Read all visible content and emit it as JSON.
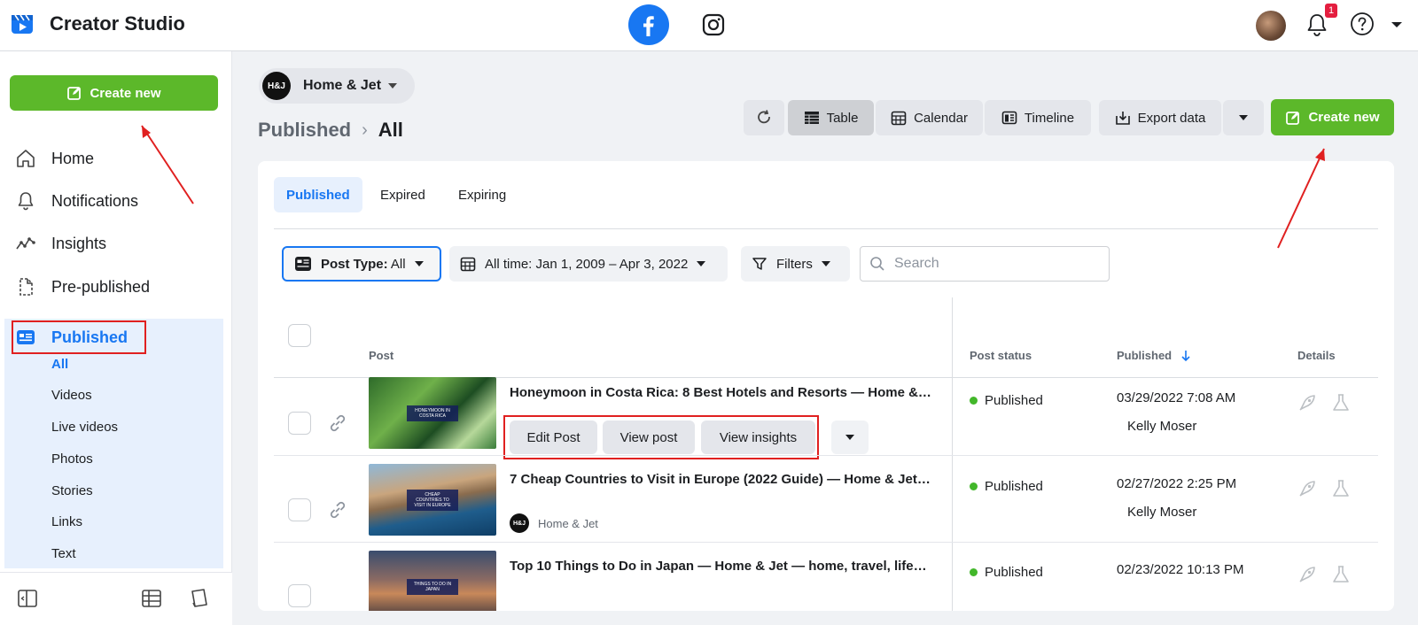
{
  "app": {
    "title": "Creator Studio",
    "notification_count": "1"
  },
  "sidebar": {
    "create_label": "Create new",
    "items": [
      {
        "label": "Home",
        "icon": "home-icon"
      },
      {
        "label": "Notifications",
        "icon": "bell-icon"
      },
      {
        "label": "Insights",
        "icon": "insights-icon"
      },
      {
        "label": "Pre-published",
        "icon": "document-icon"
      },
      {
        "label": "Published",
        "icon": "published-icon"
      }
    ],
    "subitems": [
      "All",
      "Videos",
      "Live videos",
      "Photos",
      "Stories",
      "Links",
      "Text"
    ]
  },
  "page_selector": {
    "logo_text": "H&J",
    "name": "Home & Jet"
  },
  "breadcrumb": {
    "parent": "Published",
    "current": "All"
  },
  "toolbar": {
    "views": [
      "Table",
      "Calendar",
      "Timeline"
    ],
    "export_label": "Export data",
    "create_label": "Create new"
  },
  "tabs": [
    "Published",
    "Expired",
    "Expiring"
  ],
  "filters": {
    "post_type_label": "Post Type:",
    "post_type_value": "All",
    "date_range": "All time: Jan 1, 2009 – Apr 3, 2022",
    "filters_label": "Filters",
    "search_placeholder": "Search"
  },
  "table": {
    "headers": {
      "post": "Post",
      "status": "Post status",
      "published": "Published",
      "details": "Details"
    },
    "actions": {
      "edit": "Edit Post",
      "view": "View post",
      "insights": "View insights"
    },
    "rows": [
      {
        "title": "Honeymoon in Costa Rica: 8 Best Hotels and Resorts — Home & J…",
        "thumb_text": "HONEYMOON IN COSTA RICA",
        "status": "Published",
        "date": "03/29/2022 7:08 AM",
        "author": "Kelly Moser"
      },
      {
        "title": "7 Cheap Countries to Visit in Europe (2022 Guide) — Home & Jet —…",
        "thumb_text": "CHEAP COUNTRIES TO VISIT IN EUROPE",
        "page_tag": "Home & Jet",
        "status": "Published",
        "date": "02/27/2022 2:25 PM",
        "author": "Kelly Moser"
      },
      {
        "title": "Top 10 Things to Do in Japan — Home & Jet — home, travel, lifesty…",
        "thumb_text": "THINGS TO DO IN JAPAN",
        "status": "Published",
        "date": "02/23/2022 10:13 PM"
      }
    ]
  },
  "colors": {
    "accent": "#1877f2",
    "create": "#5cb82a",
    "highlight": "#e02020",
    "status_ok": "#42b72a"
  }
}
